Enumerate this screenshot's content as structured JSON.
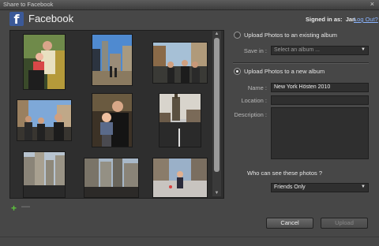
{
  "window": {
    "title": "Share to Facebook",
    "close_glyph": "×"
  },
  "header": {
    "logo_letter": "f",
    "title": "Facebook",
    "signed_in_label": "Signed in as:",
    "user": "Jan",
    "logout_label": "Log Out?"
  },
  "toolbar": {
    "add_glyph": "+",
    "remove_glyph": "—"
  },
  "existing_album": {
    "radio_label": "Upload Photos to an existing album",
    "save_in_label": "Save in :",
    "album_placeholder": "Select an album ..."
  },
  "new_album": {
    "radio_label": "Upload Photos to a new album",
    "name_label": "Name :",
    "name_value": "New York Hösten 2010",
    "location_label": "Location :",
    "location_value": "",
    "description_label": "Description :",
    "description_value": ""
  },
  "privacy": {
    "question": "Who can see these photos ?",
    "selected": "Friends Only"
  },
  "buttons": {
    "cancel": "Cancel",
    "upload": "Upload"
  },
  "photos": [
    {
      "name": "photo-1"
    },
    {
      "name": "photo-2"
    },
    {
      "name": "photo-3"
    },
    {
      "name": "photo-4"
    },
    {
      "name": "photo-5"
    },
    {
      "name": "photo-6"
    },
    {
      "name": "photo-7"
    },
    {
      "name": "photo-8"
    },
    {
      "name": "photo-9"
    }
  ],
  "colors": {
    "facebook_blue": "#3b5998",
    "link": "#8ab4ff",
    "add_green": "#5cc23c"
  }
}
